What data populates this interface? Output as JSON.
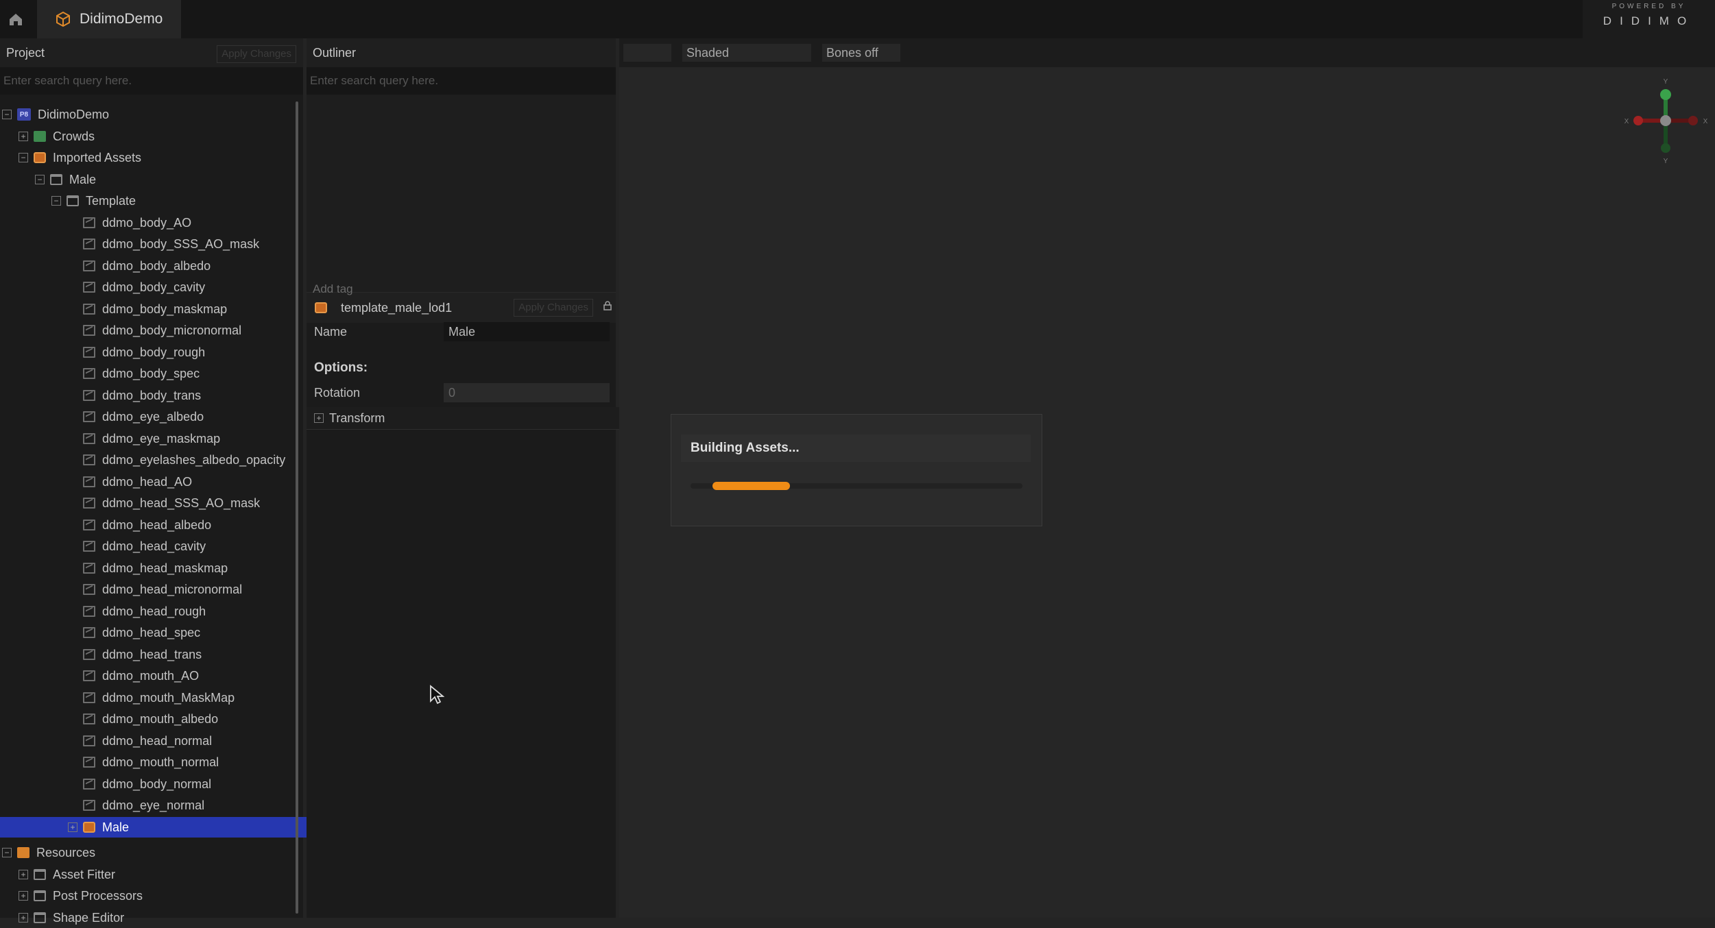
{
  "app": {
    "tab_title": "DidimoDemo",
    "logo_small": "POWERED BY",
    "logo_big": "DIDIMO"
  },
  "project": {
    "header": "Project",
    "apply_label": "Apply Changes",
    "search_placeholder": "Enter search query here.",
    "tree": [
      {
        "label": "DidimoDemo",
        "indent": 0,
        "expander": "−",
        "icon": "pb"
      },
      {
        "label": "Crowds",
        "indent": 1,
        "expander": "+",
        "icon": "folder-green"
      },
      {
        "label": "Imported Assets",
        "indent": 1,
        "expander": "−",
        "icon": "asset"
      },
      {
        "label": "Male",
        "indent": 2,
        "expander": "−",
        "icon": "folder"
      },
      {
        "label": "Template",
        "indent": 3,
        "expander": "−",
        "icon": "folder"
      },
      {
        "label": "ddmo_body_AO",
        "indent": 4,
        "icon": "texture"
      },
      {
        "label": "ddmo_body_SSS_AO_mask",
        "indent": 4,
        "icon": "texture"
      },
      {
        "label": "ddmo_body_albedo",
        "indent": 4,
        "icon": "texture"
      },
      {
        "label": "ddmo_body_cavity",
        "indent": 4,
        "icon": "texture"
      },
      {
        "label": "ddmo_body_maskmap",
        "indent": 4,
        "icon": "texture"
      },
      {
        "label": "ddmo_body_micronormal",
        "indent": 4,
        "icon": "texture"
      },
      {
        "label": "ddmo_body_rough",
        "indent": 4,
        "icon": "texture"
      },
      {
        "label": "ddmo_body_spec",
        "indent": 4,
        "icon": "texture"
      },
      {
        "label": "ddmo_body_trans",
        "indent": 4,
        "icon": "texture"
      },
      {
        "label": "ddmo_eye_albedo",
        "indent": 4,
        "icon": "texture"
      },
      {
        "label": "ddmo_eye_maskmap",
        "indent": 4,
        "icon": "texture"
      },
      {
        "label": "ddmo_eyelashes_albedo_opacity",
        "indent": 4,
        "icon": "texture"
      },
      {
        "label": "ddmo_head_AO",
        "indent": 4,
        "icon": "texture"
      },
      {
        "label": "ddmo_head_SSS_AO_mask",
        "indent": 4,
        "icon": "texture"
      },
      {
        "label": "ddmo_head_albedo",
        "indent": 4,
        "icon": "texture"
      },
      {
        "label": "ddmo_head_cavity",
        "indent": 4,
        "icon": "texture"
      },
      {
        "label": "ddmo_head_maskmap",
        "indent": 4,
        "icon": "texture"
      },
      {
        "label": "ddmo_head_micronormal",
        "indent": 4,
        "icon": "texture"
      },
      {
        "label": "ddmo_head_rough",
        "indent": 4,
        "icon": "texture"
      },
      {
        "label": "ddmo_head_spec",
        "indent": 4,
        "icon": "texture"
      },
      {
        "label": "ddmo_head_trans",
        "indent": 4,
        "icon": "texture"
      },
      {
        "label": "ddmo_mouth_AO",
        "indent": 4,
        "icon": "texture"
      },
      {
        "label": "ddmo_mouth_MaskMap",
        "indent": 4,
        "icon": "texture"
      },
      {
        "label": "ddmo_mouth_albedo",
        "indent": 4,
        "icon": "texture"
      },
      {
        "label": "ddmo_head_normal",
        "indent": 4,
        "icon": "texture"
      },
      {
        "label": "ddmo_mouth_normal",
        "indent": 4,
        "icon": "texture"
      },
      {
        "label": "ddmo_body_normal",
        "indent": 4,
        "icon": "texture"
      },
      {
        "label": "ddmo_eye_normal",
        "indent": 4,
        "icon": "texture"
      },
      {
        "label": "Male",
        "indent": 4,
        "expander": "+",
        "icon": "asset",
        "selected": true
      },
      {
        "label": "Resources",
        "indent": 0,
        "expander": "−",
        "icon": "folder-orange"
      },
      {
        "label": "Asset Fitter",
        "indent": 1,
        "expander": "+",
        "icon": "folder"
      },
      {
        "label": "Post Processors",
        "indent": 1,
        "expander": "+",
        "icon": "folder"
      },
      {
        "label": "Shape Editor",
        "indent": 1,
        "expander": "+",
        "icon": "folder"
      }
    ]
  },
  "outliner": {
    "header": "Outliner",
    "search_placeholder": "Enter search query here."
  },
  "inspector": {
    "title": "template_male_lod1",
    "apply_label": "Apply Changes",
    "add_tag": "Add tag",
    "name_label": "Name",
    "name_value": "Male",
    "options_label": "Options:",
    "rotation_label": "Rotation",
    "rotation_value": "0",
    "transform_label": "Transform"
  },
  "viewport": {
    "toolbar": {
      "blank_label": "",
      "shading_label": "Shaded",
      "bones_label": "Bones off"
    },
    "gizmo": {
      "y_label": "Y",
      "x_label": "X",
      "neg_x_label": "X",
      "neg_y_label": "Y"
    }
  },
  "dialog": {
    "title": "Building Assets...",
    "progress": 0.27
  },
  "colors": {
    "accent": "#f08c16",
    "selection": "#2637b0"
  }
}
